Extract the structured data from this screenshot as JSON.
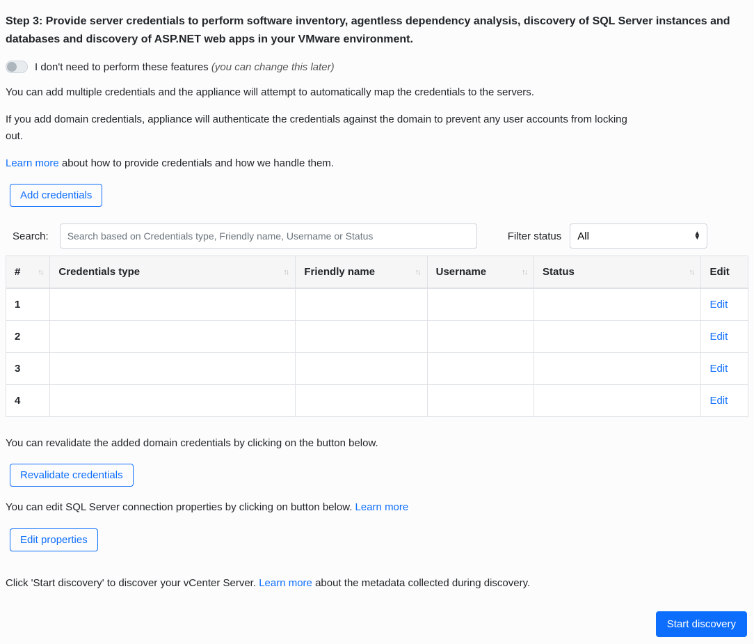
{
  "step_title": "Step 3: Provide server credentials to perform software inventory, agentless dependency analysis, discovery of SQL Server instances and databases and discovery of ASP.NET web apps in your VMware environment.",
  "toggle": {
    "label_main": "I don't need to perform these features ",
    "label_hint": "(you can change this later)"
  },
  "intro1": "You can add multiple credentials and the appliance will attempt to automatically map the credentials to the servers.",
  "intro2": "If you add domain credentials, appliance will authenticate the credentials against  the domain to prevent any user accounts from locking out.",
  "learn_more_credentials_link": "Learn more",
  "learn_more_credentials_tail": " about how to provide credentials and how we handle them.",
  "add_credentials_button": "Add credentials",
  "search": {
    "label": "Search:",
    "placeholder": "Search based on Credentials type, Friendly name, Username or Status"
  },
  "filter": {
    "label": "Filter status",
    "selected": "All"
  },
  "table": {
    "headers": {
      "num": "#",
      "type": "Credentials type",
      "name": "Friendly name",
      "user": "Username",
      "status": "Status",
      "edit": "Edit"
    },
    "rows": [
      {
        "num": "1",
        "type": "",
        "name": "",
        "user": "",
        "status": "",
        "edit": "Edit"
      },
      {
        "num": "2",
        "type": "",
        "name": "",
        "user": "",
        "status": "",
        "edit": "Edit"
      },
      {
        "num": "3",
        "type": "",
        "name": "",
        "user": "",
        "status": "",
        "edit": "Edit"
      },
      {
        "num": "4",
        "type": "",
        "name": "",
        "user": "",
        "status": "",
        "edit": "Edit"
      }
    ]
  },
  "revalidate_text": "You can revalidate the added domain credentials by clicking on the button below.",
  "revalidate_button": "Revalidate credentials",
  "sql_text_pre": "You can edit SQL Server connection properties by clicking on button below. ",
  "sql_learn_more": "Learn more",
  "edit_properties_button": "Edit properties",
  "discovery_text_pre": "Click 'Start discovery' to discover your vCenter Server. ",
  "discovery_learn_more": "Learn more",
  "discovery_text_post": " about the metadata collected during discovery.",
  "start_discovery_button": "Start discovery"
}
